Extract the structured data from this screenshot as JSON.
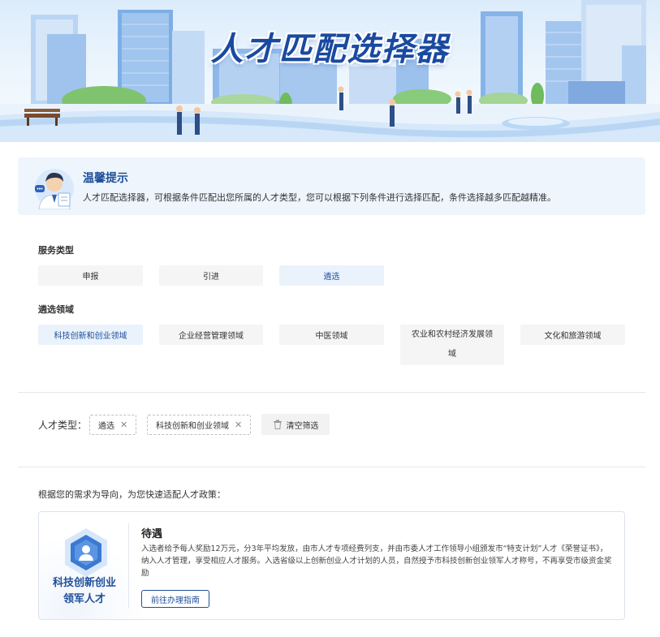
{
  "banner": {
    "title": "人才匹配选择器"
  },
  "tip": {
    "title": "温馨提示",
    "text": "人才匹配选择器，可根据条件匹配出您所属的人才类型，您可以根据下列条件进行选择匹配，条件选择越多匹配越精准。"
  },
  "service_type": {
    "label": "服务类型",
    "options": [
      "申报",
      "引进",
      "遴选"
    ],
    "selected": "遴选"
  },
  "field": {
    "label": "遴选领域",
    "options": [
      "科技创新和创业领域",
      "企业经营管理领域",
      "中医领域",
      "农业和农村经济发展领域",
      "文化和旅游领域"
    ],
    "selected": "科技创新和创业领域"
  },
  "selected_filters": {
    "label": "人才类型：",
    "tags": [
      "遴选",
      "科技创新和创业领域"
    ],
    "close_glyph": "✕",
    "clear_label": "清空筛选"
  },
  "result": {
    "guide": "根据您的需求为导向，为您快速适配人才政策：",
    "card": {
      "name_line1": "科技创新创业",
      "name_line2": "领军人才",
      "title": "待遇",
      "desc": "入选者给予每人奖励12万元，分3年平均发放，由市人才专项经费列支，并由市委人才工作领导小组颁发市“特支计划”人才《荣誉证书》，纳入人才管理，享受相应人才服务。入选省级以上创新创业人才计划的人员，自然授予市科技创新创业领军人才称号，不再享受市级资金奖励",
      "button": "前往办理指南"
    }
  },
  "colors": {
    "primary": "#1f4f9a",
    "tip_bg": "#eef5fd",
    "option_bg": "#f5f5f5",
    "option_active_bg": "#eaf2fc"
  },
  "icons": {
    "avatar": "service-staff-avatar-icon",
    "badge": "talent-badge-icon",
    "trash": "trash-icon"
  }
}
